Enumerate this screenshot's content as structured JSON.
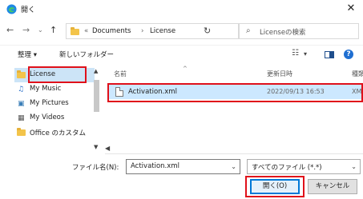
{
  "window": {
    "title": "開く",
    "close_glyph": "✕"
  },
  "icons": {
    "app": "edge-icon",
    "back": "arrow-left-icon",
    "forward": "arrow-right-icon",
    "recent": "chevron-down-icon",
    "up": "arrow-up-icon",
    "refresh": "refresh-icon",
    "search": "search-icon",
    "view": "view-mode-icon",
    "preview_pane": "preview-pane-icon",
    "help": "help-icon",
    "file": "document-icon"
  },
  "nav_buttons": {
    "back": "←",
    "forward": "→",
    "recent": "⌄",
    "up": "↑"
  },
  "address": {
    "overflow": "«",
    "crumbs": [
      "Documents",
      "License"
    ],
    "separator": "›",
    "dropdown": "⌄",
    "refresh": "↻"
  },
  "search": {
    "placeholder": "Licenseの検索",
    "glyph": "⌕"
  },
  "toolbar": {
    "organize": "整理 ▾",
    "new_folder": "新しいフォルダー",
    "view_glyph": "☷",
    "view_drop": "▾",
    "help": "?"
  },
  "nav_pane": {
    "items": [
      {
        "label": "License",
        "icon": "folder-icon",
        "selected": true
      },
      {
        "label": "My Music",
        "icon": "music-icon",
        "glyph": "♫"
      },
      {
        "label": "My Pictures",
        "icon": "pictures-icon",
        "glyph": "▣"
      },
      {
        "label": "My Videos",
        "icon": "videos-icon",
        "glyph": "▦"
      },
      {
        "label": "Office のカスタム",
        "icon": "folder-icon"
      }
    ],
    "scroll_up": "▲",
    "scroll_down": "▼",
    "scroll_left": "◀"
  },
  "file_list": {
    "columns": {
      "name": "名前",
      "modified": "更新日時",
      "type": "種類"
    },
    "sort_glyph": "^",
    "rows": [
      {
        "name": "Activation.xml",
        "modified": "2022/09/13 16:53",
        "type": "XML"
      }
    ]
  },
  "footer": {
    "filename_label": "ファイル名(N):",
    "filename_value": "Activation.xml",
    "filter_value": "すべてのファイル (*.*)",
    "drop": "⌄",
    "open": "開く(O)",
    "cancel": "キャンセル"
  },
  "highlight_color": "#e0101a",
  "accent": "#0078d7",
  "selection": "#cce8ff"
}
